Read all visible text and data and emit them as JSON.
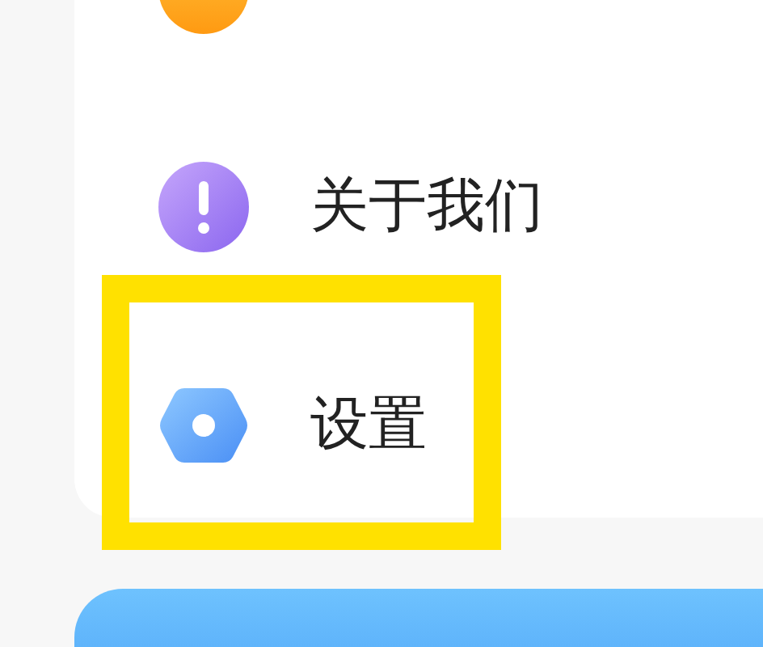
{
  "menu": {
    "items": [
      {
        "kind": "circle",
        "highlighted": false
      },
      {
        "kind": "exclamation",
        "label": "关于我们",
        "highlighted": false
      },
      {
        "kind": "hexagon",
        "label": "设置",
        "highlighted": true
      }
    ]
  }
}
